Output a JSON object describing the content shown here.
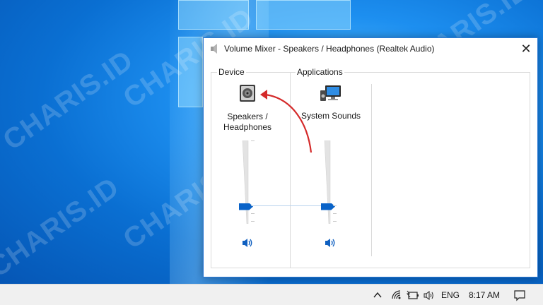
{
  "window": {
    "title": "Volume Mixer - Speakers / Headphones (Realtek Audio)",
    "close_glyph": "✕"
  },
  "device": {
    "group_label": "Device",
    "channel_label_line1": "Speakers /",
    "channel_label_line2": "Headphones",
    "icon": "speaker-device-icon",
    "volume_fraction": 0.18
  },
  "applications": {
    "group_label": "Applications",
    "channels": [
      {
        "label": "System Sounds",
        "icon": "system-sounds-icon",
        "volume_fraction": 0.18
      }
    ]
  },
  "watermark_text": "CHARIS.ID",
  "taskbar": {
    "language": "ENG",
    "time": "8:17 AM"
  },
  "colors": {
    "accent": "#0a63c8",
    "annotation_arrow": "#d42a2a",
    "window_border": "#2b79d4"
  }
}
